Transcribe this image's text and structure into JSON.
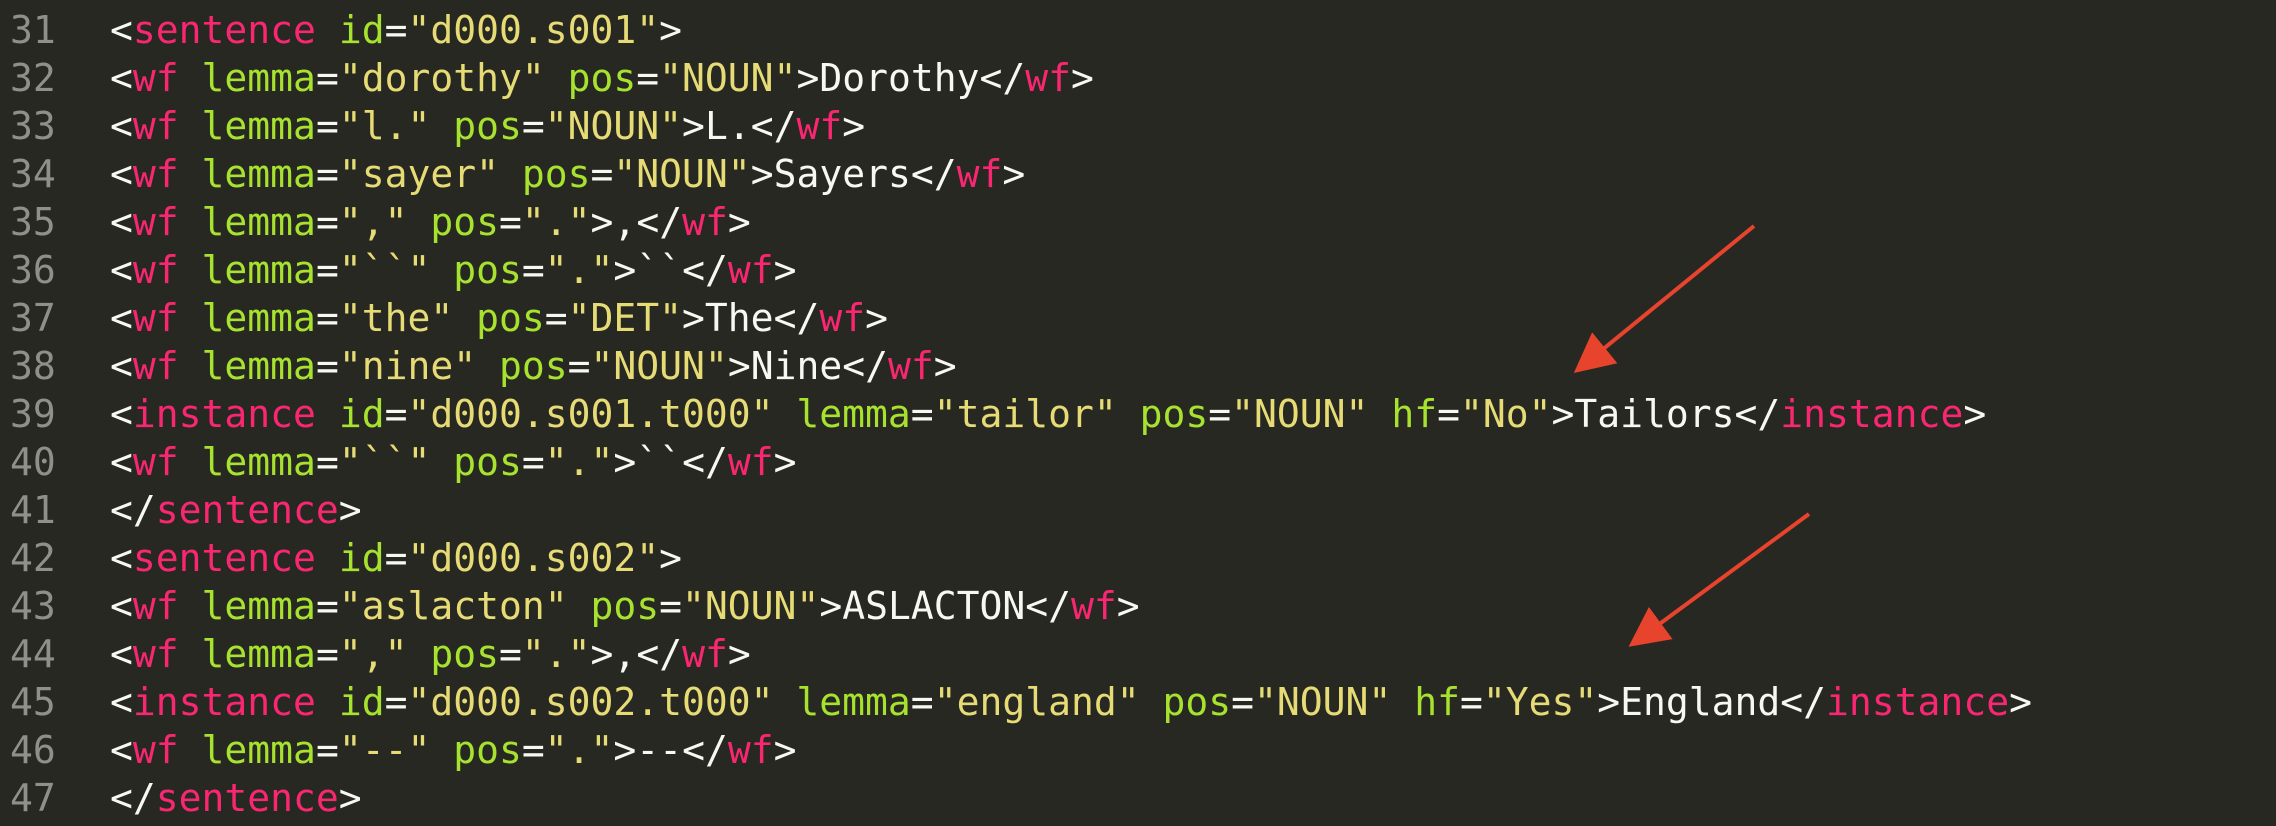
{
  "theme_colors": {
    "background": "#272822",
    "gutter": "#90908a",
    "punctuation": "#f8f8f2",
    "tag": "#f92672",
    "attribute": "#a6e22e",
    "string": "#e6db74",
    "text": "#f8f8f2",
    "annotation_arrow": "#e8432d"
  },
  "lines": [
    {
      "num": "31",
      "tokens": [
        [
          "p",
          "<"
        ],
        [
          "t",
          "sentence"
        ],
        [
          "p",
          " "
        ],
        [
          "a",
          "id"
        ],
        [
          "p",
          "="
        ],
        [
          "s",
          "\"d000.s001\""
        ],
        [
          "p",
          ">"
        ]
      ]
    },
    {
      "num": "32",
      "tokens": [
        [
          "p",
          "<"
        ],
        [
          "t",
          "wf"
        ],
        [
          "p",
          " "
        ],
        [
          "a",
          "lemma"
        ],
        [
          "p",
          "="
        ],
        [
          "s",
          "\"dorothy\""
        ],
        [
          "p",
          " "
        ],
        [
          "a",
          "pos"
        ],
        [
          "p",
          "="
        ],
        [
          "s",
          "\"NOUN\""
        ],
        [
          "p",
          ">"
        ],
        [
          "x",
          "Dorothy"
        ],
        [
          "p",
          "</"
        ],
        [
          "t",
          "wf"
        ],
        [
          "p",
          ">"
        ]
      ]
    },
    {
      "num": "33",
      "tokens": [
        [
          "p",
          "<"
        ],
        [
          "t",
          "wf"
        ],
        [
          "p",
          " "
        ],
        [
          "a",
          "lemma"
        ],
        [
          "p",
          "="
        ],
        [
          "s",
          "\"l.\""
        ],
        [
          "p",
          " "
        ],
        [
          "a",
          "pos"
        ],
        [
          "p",
          "="
        ],
        [
          "s",
          "\"NOUN\""
        ],
        [
          "p",
          ">"
        ],
        [
          "x",
          "L."
        ],
        [
          "p",
          "</"
        ],
        [
          "t",
          "wf"
        ],
        [
          "p",
          ">"
        ]
      ]
    },
    {
      "num": "34",
      "tokens": [
        [
          "p",
          "<"
        ],
        [
          "t",
          "wf"
        ],
        [
          "p",
          " "
        ],
        [
          "a",
          "lemma"
        ],
        [
          "p",
          "="
        ],
        [
          "s",
          "\"sayer\""
        ],
        [
          "p",
          " "
        ],
        [
          "a",
          "pos"
        ],
        [
          "p",
          "="
        ],
        [
          "s",
          "\"NOUN\""
        ],
        [
          "p",
          ">"
        ],
        [
          "x",
          "Sayers"
        ],
        [
          "p",
          "</"
        ],
        [
          "t",
          "wf"
        ],
        [
          "p",
          ">"
        ]
      ]
    },
    {
      "num": "35",
      "tokens": [
        [
          "p",
          "<"
        ],
        [
          "t",
          "wf"
        ],
        [
          "p",
          " "
        ],
        [
          "a",
          "lemma"
        ],
        [
          "p",
          "="
        ],
        [
          "s",
          "\",\""
        ],
        [
          "p",
          " "
        ],
        [
          "a",
          "pos"
        ],
        [
          "p",
          "="
        ],
        [
          "s",
          "\".\""
        ],
        [
          "p",
          ">"
        ],
        [
          "x",
          ","
        ],
        [
          "p",
          "</"
        ],
        [
          "t",
          "wf"
        ],
        [
          "p",
          ">"
        ]
      ]
    },
    {
      "num": "36",
      "tokens": [
        [
          "p",
          "<"
        ],
        [
          "t",
          "wf"
        ],
        [
          "p",
          " "
        ],
        [
          "a",
          "lemma"
        ],
        [
          "p",
          "="
        ],
        [
          "s",
          "\"``\""
        ],
        [
          "p",
          " "
        ],
        [
          "a",
          "pos"
        ],
        [
          "p",
          "="
        ],
        [
          "s",
          "\".\""
        ],
        [
          "p",
          ">"
        ],
        [
          "x",
          "``"
        ],
        [
          "p",
          "</"
        ],
        [
          "t",
          "wf"
        ],
        [
          "p",
          ">"
        ]
      ]
    },
    {
      "num": "37",
      "tokens": [
        [
          "p",
          "<"
        ],
        [
          "t",
          "wf"
        ],
        [
          "p",
          " "
        ],
        [
          "a",
          "lemma"
        ],
        [
          "p",
          "="
        ],
        [
          "s",
          "\"the\""
        ],
        [
          "p",
          " "
        ],
        [
          "a",
          "pos"
        ],
        [
          "p",
          "="
        ],
        [
          "s",
          "\"DET\""
        ],
        [
          "p",
          ">"
        ],
        [
          "x",
          "The"
        ],
        [
          "p",
          "</"
        ],
        [
          "t",
          "wf"
        ],
        [
          "p",
          ">"
        ]
      ]
    },
    {
      "num": "38",
      "tokens": [
        [
          "p",
          "<"
        ],
        [
          "t",
          "wf"
        ],
        [
          "p",
          " "
        ],
        [
          "a",
          "lemma"
        ],
        [
          "p",
          "="
        ],
        [
          "s",
          "\"nine\""
        ],
        [
          "p",
          " "
        ],
        [
          "a",
          "pos"
        ],
        [
          "p",
          "="
        ],
        [
          "s",
          "\"NOUN\""
        ],
        [
          "p",
          ">"
        ],
        [
          "x",
          "Nine"
        ],
        [
          "p",
          "</"
        ],
        [
          "t",
          "wf"
        ],
        [
          "p",
          ">"
        ]
      ]
    },
    {
      "num": "39",
      "tokens": [
        [
          "p",
          "<"
        ],
        [
          "t",
          "instance"
        ],
        [
          "p",
          " "
        ],
        [
          "a",
          "id"
        ],
        [
          "p",
          "="
        ],
        [
          "s",
          "\"d000.s001.t000\""
        ],
        [
          "p",
          " "
        ],
        [
          "a",
          "lemma"
        ],
        [
          "p",
          "="
        ],
        [
          "s",
          "\"tailor\""
        ],
        [
          "p",
          " "
        ],
        [
          "a",
          "pos"
        ],
        [
          "p",
          "="
        ],
        [
          "s",
          "\"NOUN\""
        ],
        [
          "p",
          " "
        ],
        [
          "a",
          "hf"
        ],
        [
          "p",
          "="
        ],
        [
          "s",
          "\"No\""
        ],
        [
          "p",
          ">"
        ],
        [
          "x",
          "Tailors"
        ],
        [
          "p",
          "</"
        ],
        [
          "t",
          "instance"
        ],
        [
          "p",
          ">"
        ]
      ]
    },
    {
      "num": "40",
      "tokens": [
        [
          "p",
          "<"
        ],
        [
          "t",
          "wf"
        ],
        [
          "p",
          " "
        ],
        [
          "a",
          "lemma"
        ],
        [
          "p",
          "="
        ],
        [
          "s",
          "\"``\""
        ],
        [
          "p",
          " "
        ],
        [
          "a",
          "pos"
        ],
        [
          "p",
          "="
        ],
        [
          "s",
          "\".\""
        ],
        [
          "p",
          ">"
        ],
        [
          "x",
          "``"
        ],
        [
          "p",
          "</"
        ],
        [
          "t",
          "wf"
        ],
        [
          "p",
          ">"
        ]
      ]
    },
    {
      "num": "41",
      "tokens": [
        [
          "p",
          "</"
        ],
        [
          "t",
          "sentence"
        ],
        [
          "p",
          ">"
        ]
      ]
    },
    {
      "num": "42",
      "tokens": [
        [
          "p",
          "<"
        ],
        [
          "t",
          "sentence"
        ],
        [
          "p",
          " "
        ],
        [
          "a",
          "id"
        ],
        [
          "p",
          "="
        ],
        [
          "s",
          "\"d000.s002\""
        ],
        [
          "p",
          ">"
        ]
      ]
    },
    {
      "num": "43",
      "tokens": [
        [
          "p",
          "<"
        ],
        [
          "t",
          "wf"
        ],
        [
          "p",
          " "
        ],
        [
          "a",
          "lemma"
        ],
        [
          "p",
          "="
        ],
        [
          "s",
          "\"aslacton\""
        ],
        [
          "p",
          " "
        ],
        [
          "a",
          "pos"
        ],
        [
          "p",
          "="
        ],
        [
          "s",
          "\"NOUN\""
        ],
        [
          "p",
          ">"
        ],
        [
          "x",
          "ASLACTON"
        ],
        [
          "p",
          "</"
        ],
        [
          "t",
          "wf"
        ],
        [
          "p",
          ">"
        ]
      ]
    },
    {
      "num": "44",
      "tokens": [
        [
          "p",
          "<"
        ],
        [
          "t",
          "wf"
        ],
        [
          "p",
          " "
        ],
        [
          "a",
          "lemma"
        ],
        [
          "p",
          "="
        ],
        [
          "s",
          "\",\""
        ],
        [
          "p",
          " "
        ],
        [
          "a",
          "pos"
        ],
        [
          "p",
          "="
        ],
        [
          "s",
          "\".\""
        ],
        [
          "p",
          ">"
        ],
        [
          "x",
          ","
        ],
        [
          "p",
          "</"
        ],
        [
          "t",
          "wf"
        ],
        [
          "p",
          ">"
        ]
      ]
    },
    {
      "num": "45",
      "tokens": [
        [
          "p",
          "<"
        ],
        [
          "t",
          "instance"
        ],
        [
          "p",
          " "
        ],
        [
          "a",
          "id"
        ],
        [
          "p",
          "="
        ],
        [
          "s",
          "\"d000.s002.t000\""
        ],
        [
          "p",
          " "
        ],
        [
          "a",
          "lemma"
        ],
        [
          "p",
          "="
        ],
        [
          "s",
          "\"england\""
        ],
        [
          "p",
          " "
        ],
        [
          "a",
          "pos"
        ],
        [
          "p",
          "="
        ],
        [
          "s",
          "\"NOUN\""
        ],
        [
          "p",
          " "
        ],
        [
          "a",
          "hf"
        ],
        [
          "p",
          "="
        ],
        [
          "s",
          "\"Yes\""
        ],
        [
          "p",
          ">"
        ],
        [
          "x",
          "England"
        ],
        [
          "p",
          "</"
        ],
        [
          "t",
          "instance"
        ],
        [
          "p",
          ">"
        ]
      ]
    },
    {
      "num": "46",
      "tokens": [
        [
          "p",
          "<"
        ],
        [
          "t",
          "wf"
        ],
        [
          "p",
          " "
        ],
        [
          "a",
          "lemma"
        ],
        [
          "p",
          "="
        ],
        [
          "s",
          "\"--\""
        ],
        [
          "p",
          " "
        ],
        [
          "a",
          "pos"
        ],
        [
          "p",
          "="
        ],
        [
          "s",
          "\".\""
        ],
        [
          "p",
          ">"
        ],
        [
          "x",
          "--"
        ],
        [
          "p",
          "</"
        ],
        [
          "t",
          "wf"
        ],
        [
          "p",
          ">"
        ]
      ]
    },
    {
      "num": "47",
      "tokens": [
        [
          "p",
          "</"
        ],
        [
          "t",
          "sentence"
        ],
        [
          "p",
          ">"
        ]
      ]
    }
  ]
}
